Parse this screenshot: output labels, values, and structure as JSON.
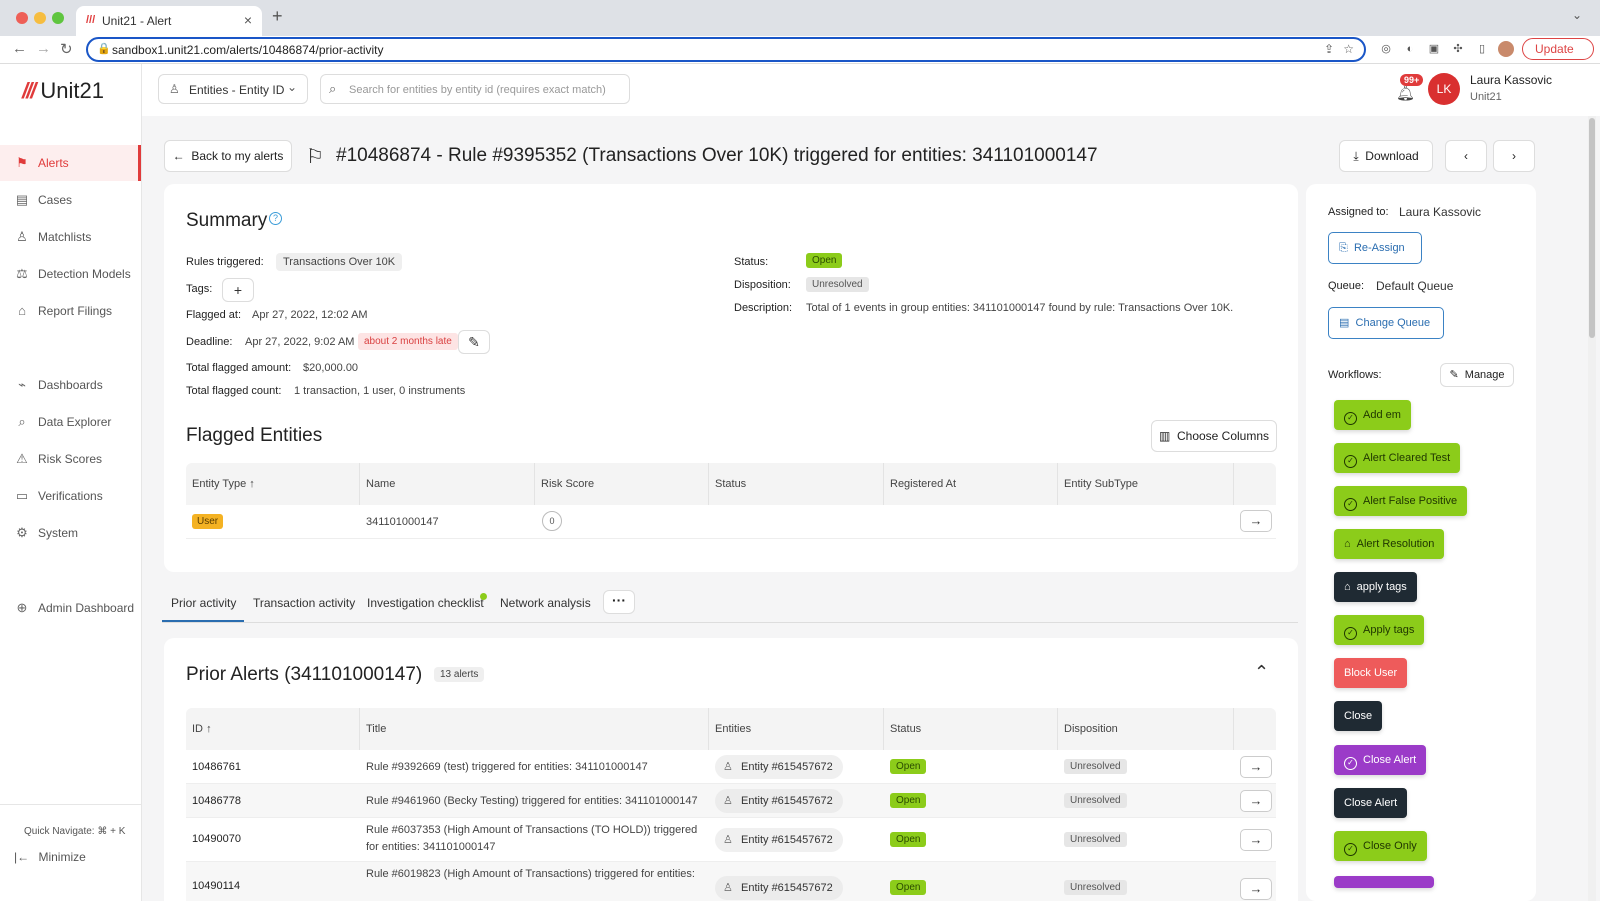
{
  "browser": {
    "tab_title": "Unit21 - Alert",
    "url": "sandbox1.unit21.com/alerts/10486874/prior-activity",
    "update_label": "Update"
  },
  "sidebar": {
    "logo": "Unit21",
    "items": [
      {
        "label": "Alerts",
        "icon": "flag-icon",
        "active": true
      },
      {
        "label": "Cases",
        "icon": "briefcase-icon"
      },
      {
        "label": "Matchlists",
        "icon": "user-list-icon"
      },
      {
        "label": "Detection Models",
        "icon": "scale-icon"
      },
      {
        "label": "Report Filings",
        "icon": "bank-icon"
      },
      {
        "label": "Dashboards",
        "icon": "chart-icon"
      },
      {
        "label": "Data Explorer",
        "icon": "explore-icon"
      },
      {
        "label": "Risk Scores",
        "icon": "warning-icon"
      },
      {
        "label": "Verifications",
        "icon": "id-card-icon"
      },
      {
        "label": "System",
        "icon": "gear-icon"
      },
      {
        "label": "Admin Dashboard",
        "icon": "globe-icon"
      }
    ],
    "quick_navigate": "Quick Navigate: ⌘ + K",
    "minimize": "Minimize"
  },
  "header": {
    "entity_select": "Entities - Entity ID",
    "search_placeholder": "Search for entities by entity id (requires exact match)",
    "notif_badge": "99+",
    "user_initials": "LK",
    "user_name": "Laura Kassovic",
    "user_org": "Unit21"
  },
  "page": {
    "back_label": "Back to my alerts",
    "title": "#10486874 - Rule #9395352 (Transactions Over 10K) triggered for entities: 341101000147",
    "download_label": "Download"
  },
  "summary": {
    "heading": "Summary",
    "rules_label": "Rules triggered:",
    "rules_value": "Transactions Over 10K",
    "tags_label": "Tags:",
    "flagged_at_label": "Flagged at:",
    "flagged_at_value": "Apr 27, 2022, 12:02 AM",
    "deadline_label": "Deadline:",
    "deadline_value": "Apr 27, 2022, 9:02 AM",
    "deadline_late": "about 2 months late",
    "amount_label": "Total flagged amount:",
    "amount_value": "$20,000.00",
    "count_label": "Total flagged count:",
    "count_value": "1 transaction, 1 user, 0 instruments",
    "status_label": "Status:",
    "status_value": "Open",
    "disposition_label": "Disposition:",
    "disposition_value": "Unresolved",
    "description_label": "Description:",
    "description_value": "Total of 1 events in group entities: 341101000147 found by rule: Transactions Over 10K."
  },
  "flagged_entities": {
    "heading": "Flagged Entities",
    "choose_columns": "Choose Columns",
    "columns": [
      "Entity Type",
      "Name",
      "Risk Score",
      "Status",
      "Registered At",
      "Entity SubType"
    ],
    "rows": [
      {
        "type": "User",
        "name": "341101000147",
        "risk": "0"
      }
    ]
  },
  "tabs": [
    {
      "label": "Prior activity",
      "active": true
    },
    {
      "label": "Transaction activity"
    },
    {
      "label": "Investigation checklist"
    },
    {
      "label": "Network analysis"
    }
  ],
  "prior_alerts": {
    "heading": "Prior Alerts (341101000147)",
    "count_badge": "13 alerts",
    "columns": [
      "ID",
      "Title",
      "Entities",
      "Status",
      "Disposition"
    ],
    "rows": [
      {
        "id": "10486761",
        "title": "Rule #9392669 (test) triggered for entities: 341101000147",
        "entity": "Entity #615457672",
        "status": "Open",
        "disposition": "Unresolved"
      },
      {
        "id": "10486778",
        "title": "Rule #9461960 (Becky Testing) triggered for entities: 341101000147",
        "entity": "Entity #615457672",
        "status": "Open",
        "disposition": "Unresolved"
      },
      {
        "id": "10490070",
        "title_1": "Rule #6037353 (High Amount of Transactions (TO HOLD)) triggered",
        "title_2": "for entities: 341101000147",
        "entity": "Entity #615457672",
        "status": "Open",
        "disposition": "Unresolved"
      },
      {
        "id": "10490114",
        "title_1": "Rule #6019823 (High Amount of Transactions) triggered for entities:",
        "entity": "Entity #615457672",
        "status": "Open",
        "disposition": "Unresolved"
      }
    ]
  },
  "right_panel": {
    "assigned_label": "Assigned to:",
    "assigned_value": "Laura Kassovic",
    "reassign": "Re-Assign",
    "queue_label": "Queue:",
    "queue_value": "Default Queue",
    "change_queue": "Change Queue",
    "workflows_label": "Workflows:",
    "manage": "Manage",
    "workflows": [
      {
        "label": "Add em",
        "style": "green",
        "icon": "check-circle-icon"
      },
      {
        "label": "Alert Cleared Test",
        "style": "green",
        "icon": "check-circle-icon"
      },
      {
        "label": "Alert False Positive",
        "style": "green",
        "icon": "check-circle-icon"
      },
      {
        "label": "Alert Resolution",
        "style": "green",
        "icon": "tag-icon"
      },
      {
        "label": "apply tags",
        "style": "dark",
        "icon": "tag-icon"
      },
      {
        "label": "Apply tags",
        "style": "green",
        "icon": "check-circle-icon"
      },
      {
        "label": "Block User",
        "style": "red"
      },
      {
        "label": "Close",
        "style": "dark"
      },
      {
        "label": "Close Alert",
        "style": "purple",
        "icon": "check-circle-icon"
      },
      {
        "label": "Close Alert",
        "style": "dark"
      },
      {
        "label": "Close Only",
        "style": "green",
        "icon": "check-circle-icon"
      }
    ]
  },
  "colors": {
    "accent_red": "#e03b3b",
    "open_green": "#8ccc1a",
    "link_blue": "#2a6db0",
    "dark_button": "#1f2a33",
    "purple_button": "#9b3bc8"
  }
}
